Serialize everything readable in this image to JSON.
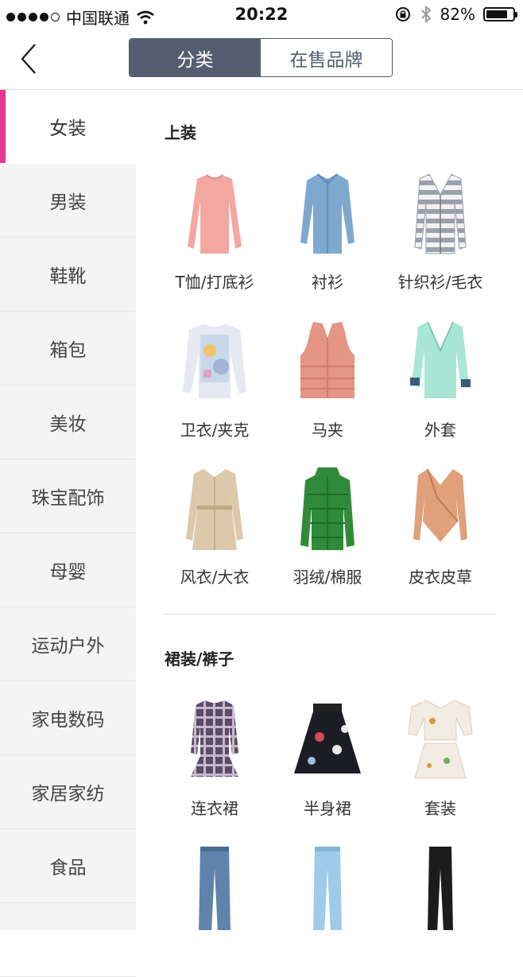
{
  "status": {
    "carrier": "中国联通",
    "time": "20:22",
    "battery": "82%",
    "battery_level": 0.82
  },
  "nav": {
    "tabs": [
      "分类",
      "在售品牌"
    ]
  },
  "sidebar": [
    "女装",
    "男装",
    "鞋靴",
    "箱包",
    "美妆",
    "珠宝配饰",
    "母婴",
    "运动户外",
    "家电数码",
    "家居家纺",
    "食品"
  ],
  "sections": [
    {
      "title": "上装",
      "items": [
        "T恤/打底衫",
        "衬衫",
        "针织衫/毛衣",
        "卫衣/夹克",
        "马夹",
        "外套",
        "风衣/大衣",
        "羽绒/棉服",
        "皮衣皮草"
      ]
    },
    {
      "title": "裙装/裤子",
      "items": [
        "连衣裙",
        "半身裙",
        "套装"
      ]
    }
  ]
}
